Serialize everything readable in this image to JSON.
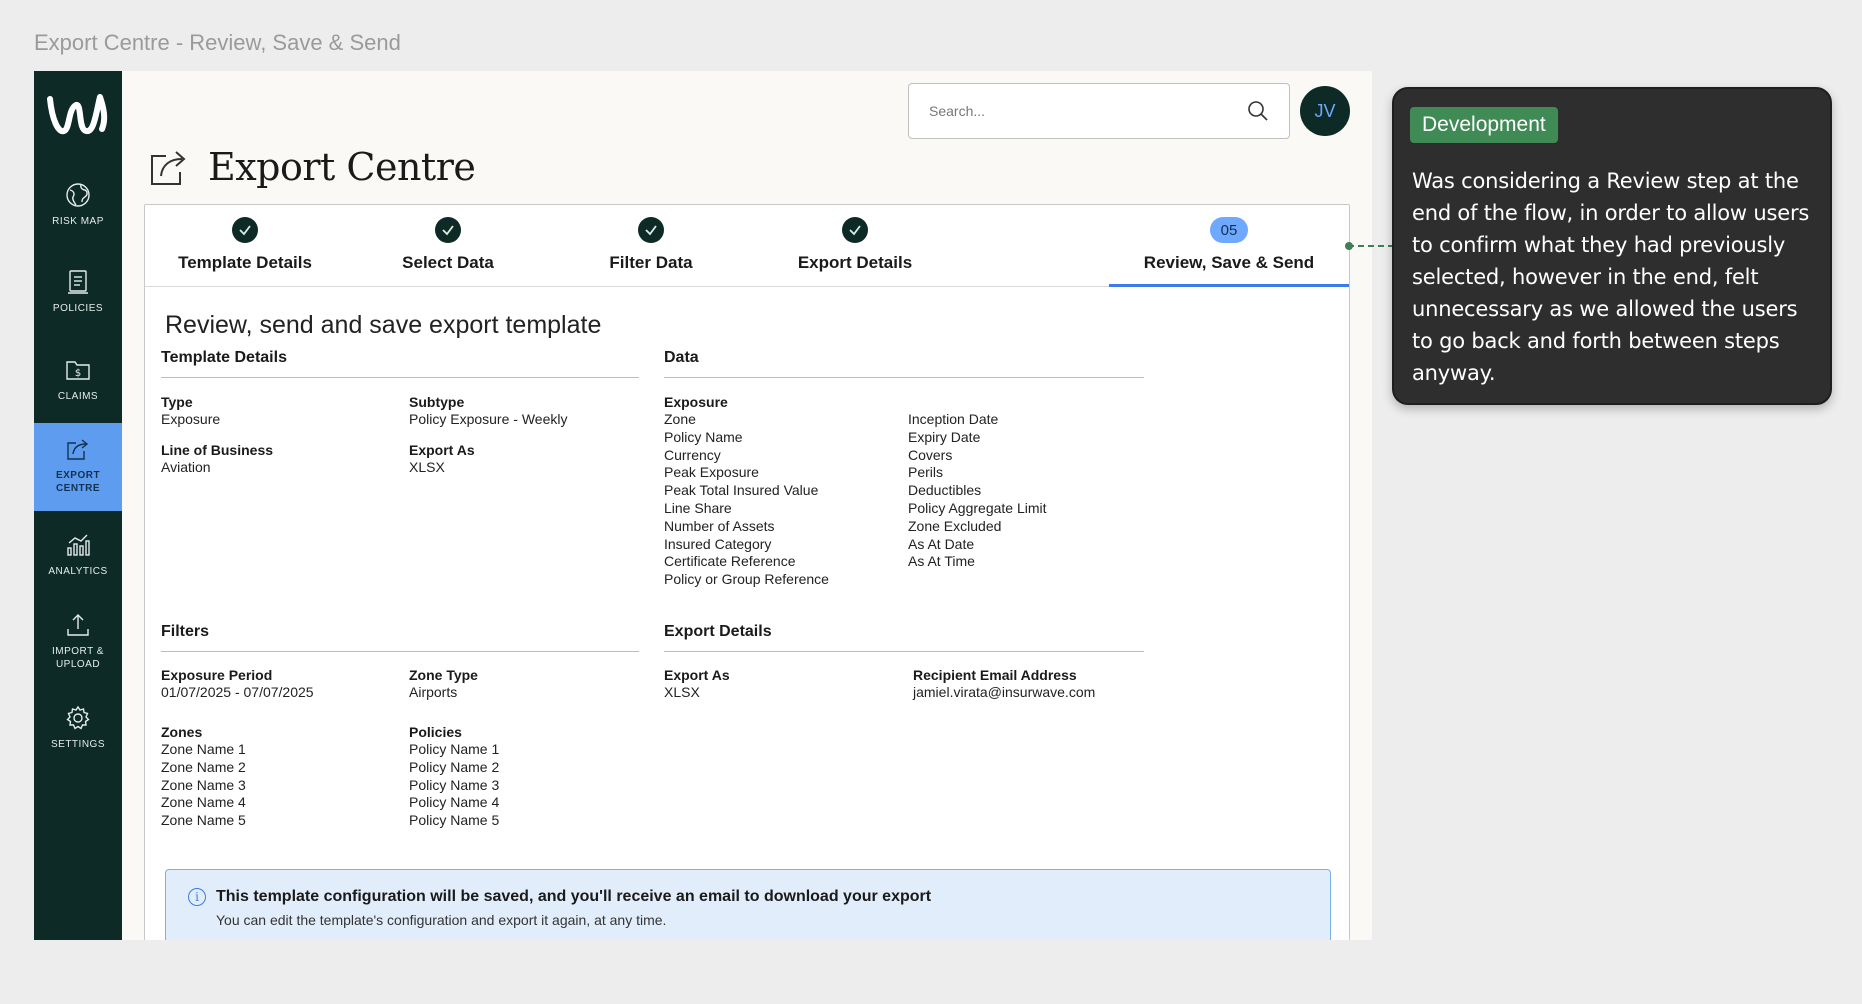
{
  "frame_title": "Export Centre - Review, Save & Send",
  "sidebar": {
    "items": [
      {
        "label": "RISK MAP",
        "icon": "globe-icon"
      },
      {
        "label": "POLICIES",
        "icon": "document-icon"
      },
      {
        "label": "CLAIMS",
        "icon": "folder-dollar-icon"
      },
      {
        "label": "EXPORT CENTRE",
        "icon": "export-icon"
      },
      {
        "label": "ANALYTICS",
        "icon": "analytics-icon"
      },
      {
        "label": "IMPORT & UPLOAD",
        "icon": "upload-icon"
      },
      {
        "label": "SETTINGS",
        "icon": "gear-icon"
      }
    ],
    "active": "EXPORT CENTRE"
  },
  "header": {
    "search_placeholder": "Search...",
    "avatar_initials": "JV"
  },
  "page": {
    "title": "Export Centre"
  },
  "stepper": {
    "steps": [
      {
        "label": "Template Details",
        "status": "complete"
      },
      {
        "label": "Select Data",
        "status": "complete"
      },
      {
        "label": "Filter Data",
        "status": "complete"
      },
      {
        "label": "Export Details",
        "status": "complete"
      },
      {
        "label": "Review, Save & Send",
        "status": "active",
        "number": "05"
      }
    ]
  },
  "review": {
    "heading": "Review, send and save export template",
    "template_details": {
      "title": "Template Details",
      "type_label": "Type",
      "type_value": "Exposure",
      "subtype_label": "Subtype",
      "subtype_value": "Policy Exposure - Weekly",
      "lob_label": "Line of Business",
      "lob_value": "Aviation",
      "export_as_label": "Export As",
      "export_as_value": "XLSX"
    },
    "data": {
      "title": "Data",
      "group_label": "Exposure",
      "col1": [
        "Zone",
        "Policy Name",
        "Currency",
        "Peak Exposure",
        "Peak Total Insured Value",
        "Line Share",
        "Number of Assets",
        "Insured Category",
        "Certificate Reference",
        "Policy or Group Reference"
      ],
      "col2": [
        "Inception Date",
        "Expiry Date",
        "Covers",
        "Perils",
        "Deductibles",
        "Policy Aggregate Limit",
        "Zone Excluded",
        "As At Date",
        "As At Time"
      ]
    },
    "filters": {
      "title": "Filters",
      "period_label": "Exposure Period",
      "period_value": "01/07/2025 - 07/07/2025",
      "zone_type_label": "Zone Type",
      "zone_type_value": "Airports",
      "zones_label": "Zones",
      "zones": [
        "Zone Name 1",
        "Zone Name 2",
        "Zone Name 3",
        "Zone Name 4",
        "Zone Name 5"
      ],
      "policies_label": "Policies",
      "policies": [
        "Policy Name 1",
        "Policy Name 2",
        "Policy Name 3",
        "Policy Name 4",
        "Policy Name 5"
      ]
    },
    "export_details": {
      "title": "Export Details",
      "export_as_label": "Export As",
      "export_as_value": "XLSX",
      "email_label": "Recipient Email Address",
      "email_value": "jamiel.virata@insurwave.com"
    },
    "info": {
      "icon": "info-icon",
      "title": "This template configuration will be saved, and you'll receive an email to download your export",
      "text": "You can edit the template's configuration and export it again, at any time."
    }
  },
  "note": {
    "tag": "Development",
    "text": "Was considering a Review step at the end of the flow, in order to allow users to confirm what they had previously selected, however in the end, felt unnecessary as we allowed the users to go back and forth between steps anyway.",
    "tag_color": "#3f8a55"
  },
  "colors": {
    "sidebar_bg": "#0d2a26",
    "accent": "#5e9cf0",
    "active_tab": "#3d7be8"
  }
}
